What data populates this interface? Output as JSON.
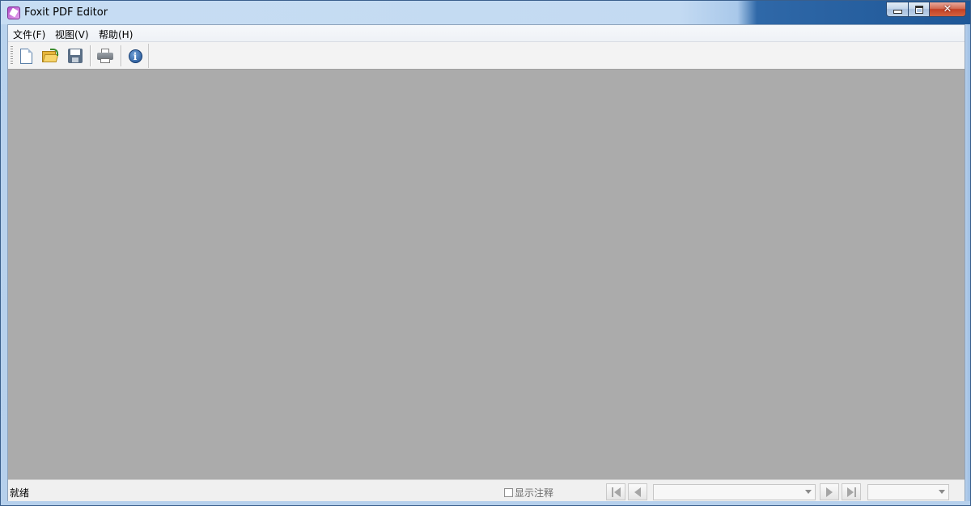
{
  "window": {
    "title": "Foxit PDF Editor",
    "app_icon": "foxit-pdf-icon",
    "caption_buttons": [
      "minimize",
      "maximize",
      "close"
    ],
    "close_glyph": "✕"
  },
  "menu": {
    "items": [
      {
        "label": "文件(F)"
      },
      {
        "label": "视图(V)"
      },
      {
        "label": "帮助(H)"
      }
    ]
  },
  "toolbar": {
    "buttons": [
      {
        "icon": "new-document-icon"
      },
      {
        "icon": "open-folder-icon"
      },
      {
        "icon": "save-disk-icon"
      },
      {
        "icon": "print-icon"
      },
      {
        "icon": "info-icon",
        "glyph": "i"
      }
    ]
  },
  "document_area": {
    "background": "#ababab"
  },
  "statusbar": {
    "status_text": "就绪",
    "show_annotations_label": "显示注释",
    "show_annotations_checked": false,
    "page_input_value": "",
    "zoom_value": "",
    "nav_buttons": [
      "first-page",
      "previous-page",
      "next-page",
      "last-page"
    ]
  },
  "colors": {
    "titlebar_light": "#c7ddf3",
    "titlebar_dark": "#1e5797",
    "close_button": "#c34024",
    "doc_background": "#ababab"
  }
}
